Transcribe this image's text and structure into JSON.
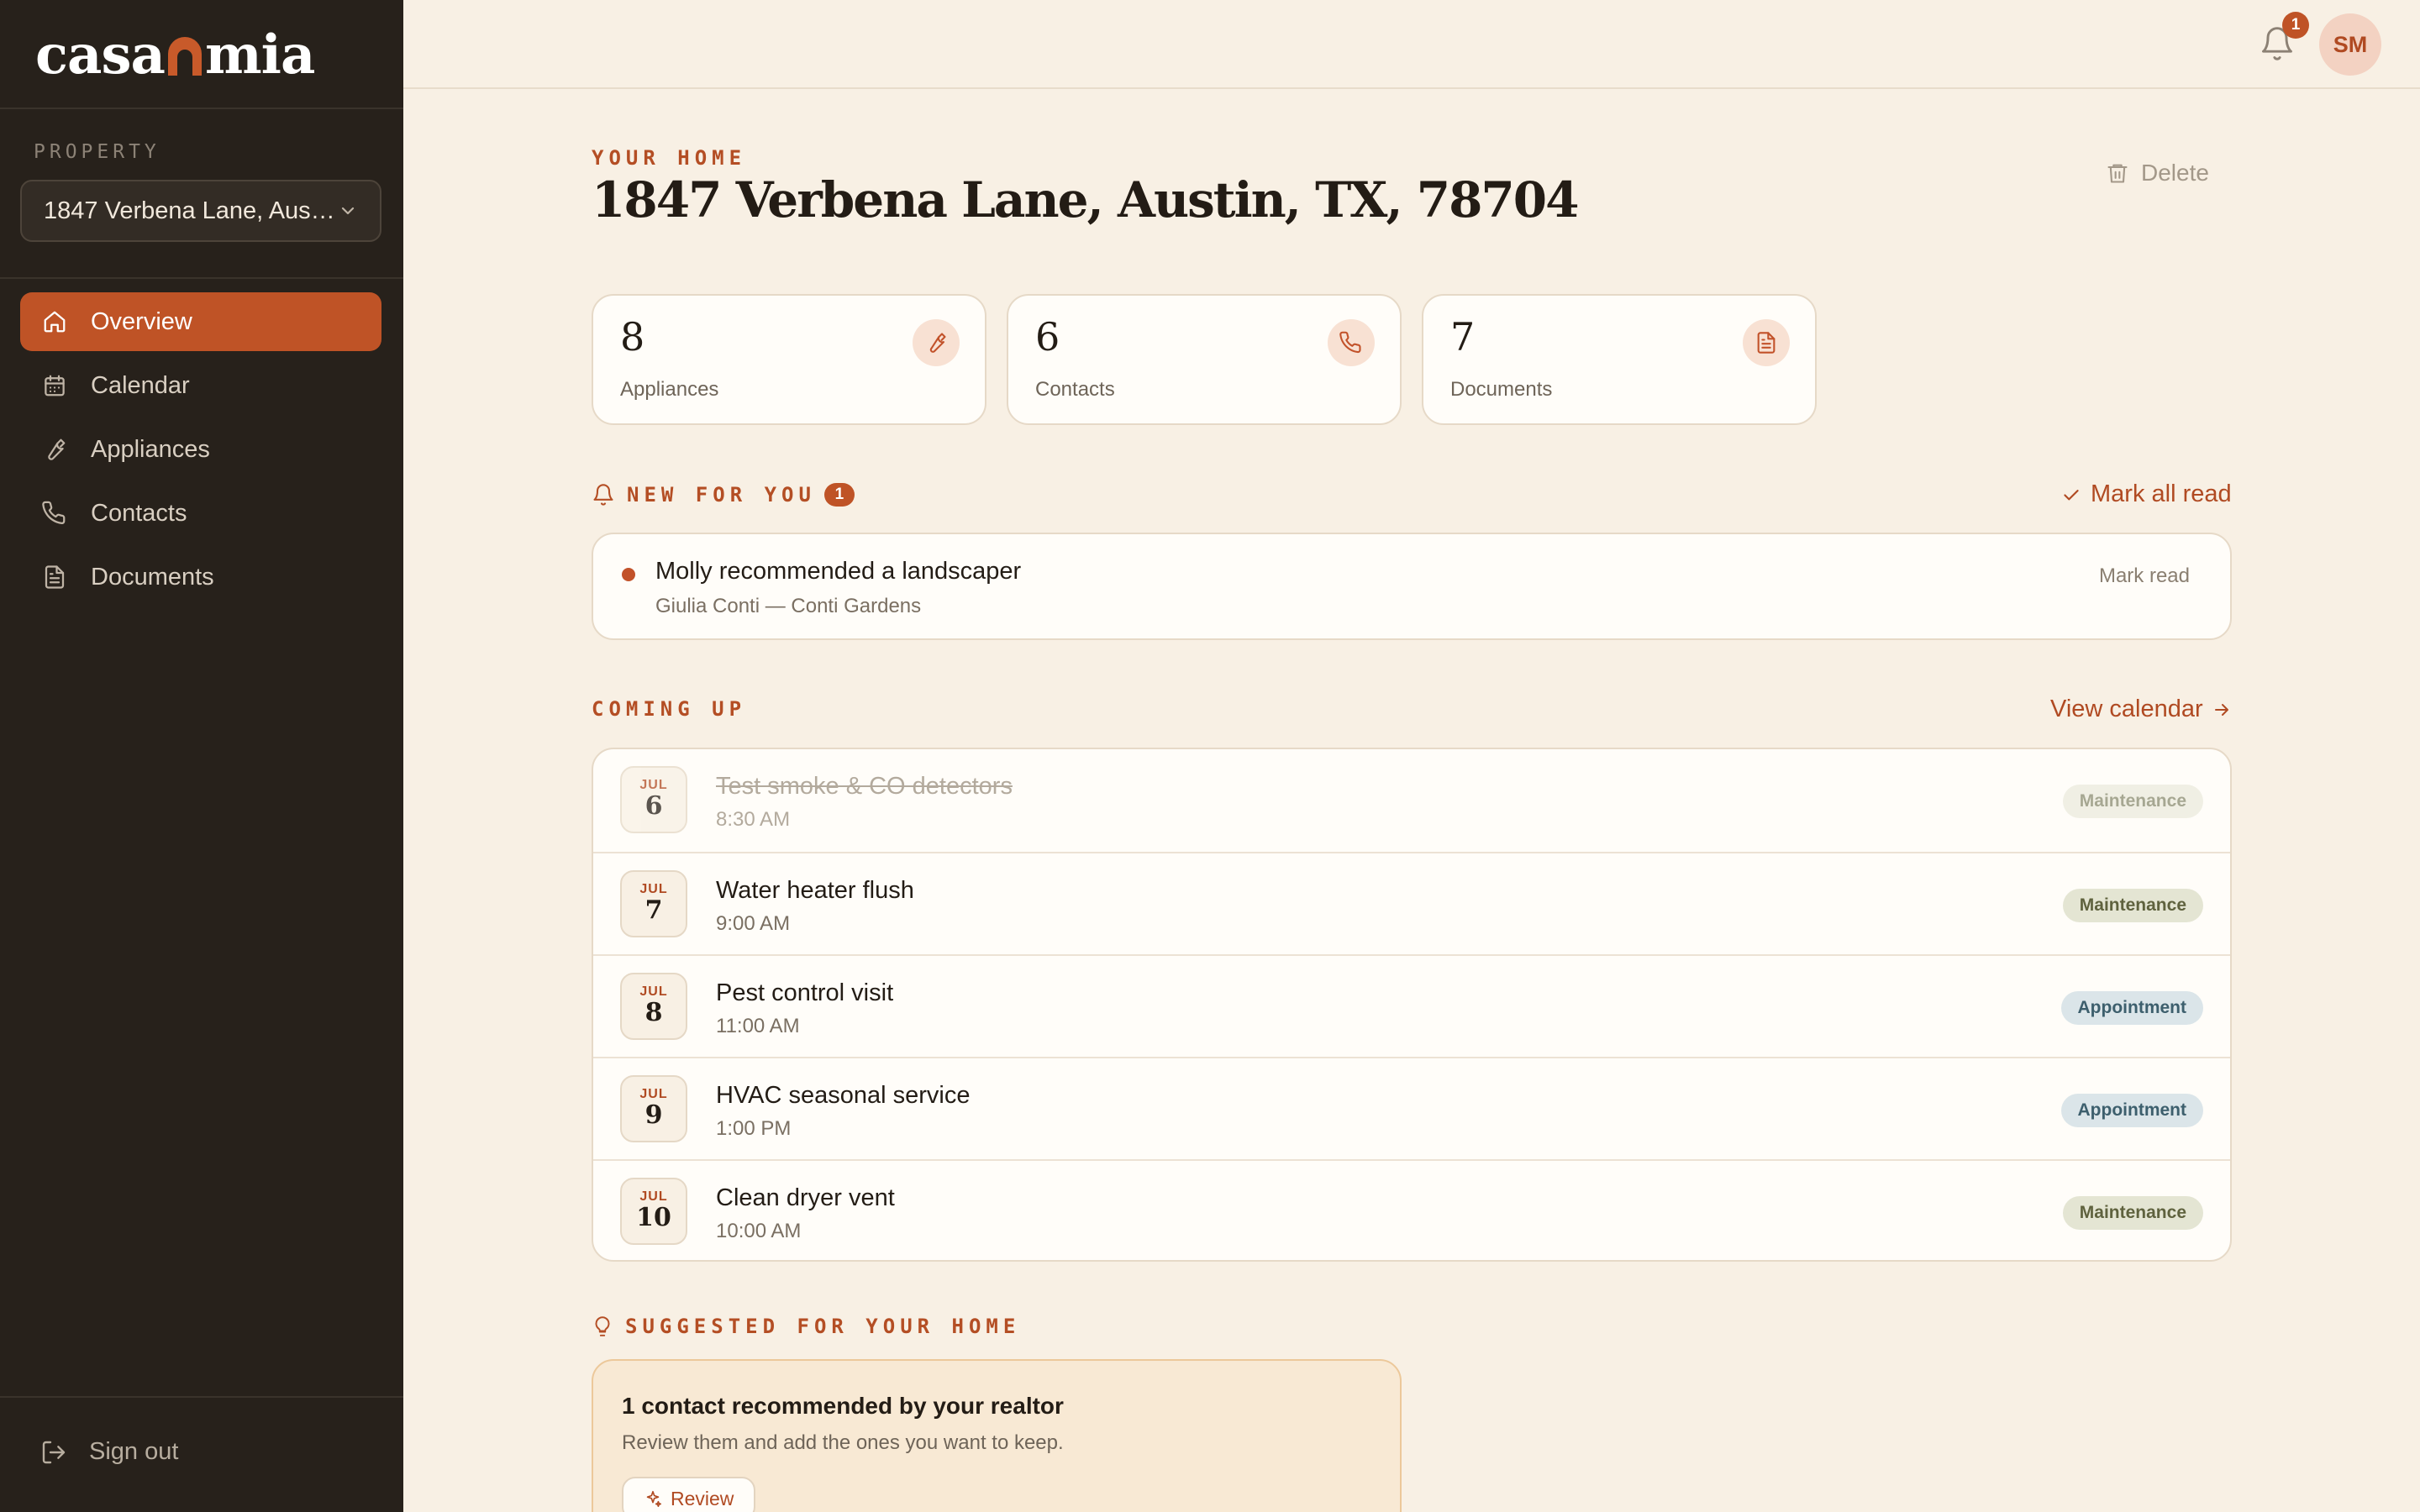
{
  "app": {
    "logo_left": "casa",
    "logo_right": "mia"
  },
  "sidebar": {
    "property_label": "PROPERTY",
    "property_value": "1847 Verbena Lane, Austin, TX, 78704",
    "nav": [
      {
        "label": "Overview",
        "icon": "home-icon",
        "active": true
      },
      {
        "label": "Calendar",
        "icon": "calendar-icon",
        "active": false
      },
      {
        "label": "Appliances",
        "icon": "wrench-icon",
        "active": false
      },
      {
        "label": "Contacts",
        "icon": "phone-icon",
        "active": false
      },
      {
        "label": "Documents",
        "icon": "document-icon",
        "active": false
      }
    ],
    "sign_out": "Sign out"
  },
  "topbar": {
    "notification_count": "1",
    "avatar_initials": "SM"
  },
  "page": {
    "eyebrow": "YOUR HOME",
    "title": "1847 Verbena Lane, Austin, TX, 78704",
    "delete_label": "Delete"
  },
  "stats": [
    {
      "value": "8",
      "label": "Appliances",
      "icon": "wrench-icon"
    },
    {
      "value": "6",
      "label": "Contacts",
      "icon": "phone-icon"
    },
    {
      "value": "7",
      "label": "Documents",
      "icon": "document-icon"
    }
  ],
  "new_for_you": {
    "heading": "NEW FOR YOU",
    "count": "1",
    "mark_all_read": "Mark all read",
    "items": [
      {
        "title": "Molly recommended a landscaper",
        "subtitle": "Giulia Conti — Conti Gardens",
        "action": "Mark read"
      }
    ]
  },
  "coming_up": {
    "heading": "COMING UP",
    "view_calendar": "View calendar",
    "events": [
      {
        "month": "JUL",
        "day": "6",
        "title": "Test smoke & CO detectors",
        "time": "8:30 AM",
        "tag": "Maintenance",
        "done": true
      },
      {
        "month": "JUL",
        "day": "7",
        "title": "Water heater flush",
        "time": "9:00 AM",
        "tag": "Maintenance",
        "done": false
      },
      {
        "month": "JUL",
        "day": "8",
        "title": "Pest control visit",
        "time": "11:00 AM",
        "tag": "Appointment",
        "done": false
      },
      {
        "month": "JUL",
        "day": "9",
        "title": "HVAC seasonal service",
        "time": "1:00 PM",
        "tag": "Appointment",
        "done": false
      },
      {
        "month": "JUL",
        "day": "10",
        "title": "Clean dryer vent",
        "time": "10:00 AM",
        "tag": "Maintenance",
        "done": false
      }
    ]
  },
  "suggested": {
    "heading": "SUGGESTED FOR YOUR HOME",
    "card_title": "1 contact recommended by your realtor",
    "card_text": "Review them and add the ones you want to keep.",
    "button": "Review"
  },
  "colors": {
    "accent": "#bf5326",
    "sidebar_bg": "#27211b",
    "page_bg": "#f8f0e4",
    "maintenance_tag": "#e4e5d3",
    "appointment_tag": "#dbe5e9"
  }
}
